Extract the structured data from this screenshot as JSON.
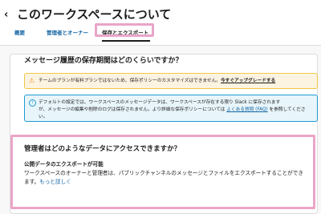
{
  "header": {
    "back_glyph": "‹",
    "title": "このワークスペースについて"
  },
  "tabs": [
    {
      "label": "概要"
    },
    {
      "label": "管理者とオーナー"
    },
    {
      "label": "保存とエクスポート",
      "active": true
    }
  ],
  "retention": {
    "title": "メッセージ履歴の保存期間はどのくらいですか？",
    "warning_icon": "warning-icon",
    "warning_text": "チームのプランが有料プランではないため、保存ポリシーのカスタマイズはできません。",
    "warning_link": "今すぐアップグレードする",
    "info_icon": "info-icon",
    "info_text_1": "デフォルトの設定では、ワークスペースのメッセージデータは、ワークスペースが存在する限り Slack に保存されます",
    "info_text_2": "が、メッセージの編集や削除のログは保存されません。より詳細な保存ポリシーについては",
    "info_link": "よくある質問 (FAQ)",
    "info_text_3": "を参照してください。"
  },
  "admin_access": {
    "title": "管理者はどのようなデータにアクセスできますか？",
    "subtitle": "公開データのエクスポートが可能",
    "body": "ワークスペースのオーナーと管理者は、パブリックチャンネルのメッセージとファイルをエクスポートすることができます。",
    "link": "もっと詳しく"
  },
  "colors": {
    "highlight": "#eaa5c8",
    "link": "#1264a3",
    "warning_bg": "#fdf3e1",
    "info_bg": "#e8f5fa"
  }
}
